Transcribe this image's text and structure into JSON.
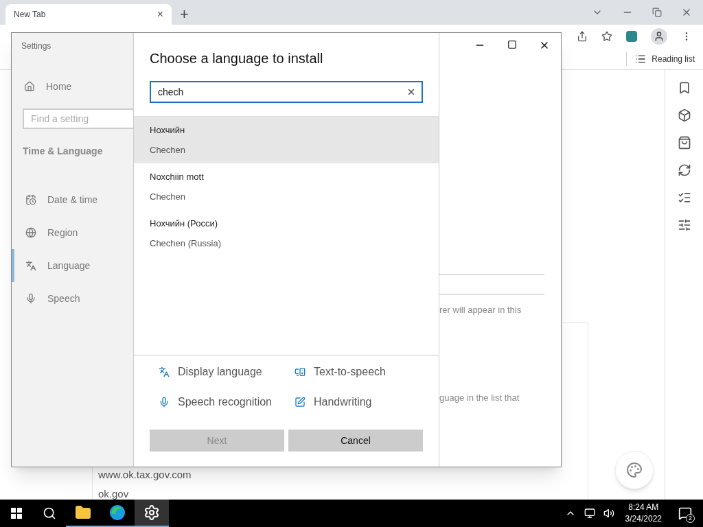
{
  "browser": {
    "tab": {
      "title": "New Tab",
      "close": "×"
    },
    "new_tab": "+",
    "bookmarks_bar": {
      "reading_list": "Reading list"
    },
    "content": {
      "links": [
        "www.ok.tax.gov.com",
        "ok.gov"
      ]
    }
  },
  "settings": {
    "title": "Settings",
    "home": "Home",
    "search": {
      "placeholder": "Find a setting"
    },
    "section": "Time & Language",
    "items": [
      {
        "label": "Date & time",
        "kind": "calendar",
        "selected": false
      },
      {
        "label": "Region",
        "kind": "globe",
        "selected": false
      },
      {
        "label": "Language",
        "kind": "language",
        "selected": true
      },
      {
        "label": "Speech",
        "kind": "mic",
        "selected": false
      }
    ],
    "background_fragments": [
      "rer will appear in this",
      "guage in the list that"
    ]
  },
  "dialog": {
    "title": "Choose a language to install",
    "search": {
      "value": "chech"
    },
    "results": [
      {
        "native": "Нохчийн",
        "name": "Chechen",
        "selected": true
      },
      {
        "native": "Noxchiin mott",
        "name": "Chechen",
        "selected": false
      },
      {
        "native": "Нохчийн (Росси)",
        "name": "Chechen (Russia)",
        "selected": false
      }
    ],
    "features": [
      {
        "label": "Display language",
        "kind": "language"
      },
      {
        "label": "Text-to-speech",
        "kind": "speech"
      },
      {
        "label": "Speech recognition",
        "kind": "mic"
      },
      {
        "label": "Handwriting",
        "kind": "pen"
      }
    ],
    "buttons": [
      {
        "label": "Next",
        "disabled": true
      },
      {
        "label": "Cancel",
        "disabled": false
      }
    ]
  },
  "taskbar": {
    "apps": [
      {
        "kind": "explorer",
        "selected": false
      },
      {
        "kind": "edge",
        "selected": false
      },
      {
        "kind": "settings",
        "selected": true
      }
    ],
    "time": "8:24 AM",
    "date": "3/24/2022",
    "notifications": "2"
  }
}
